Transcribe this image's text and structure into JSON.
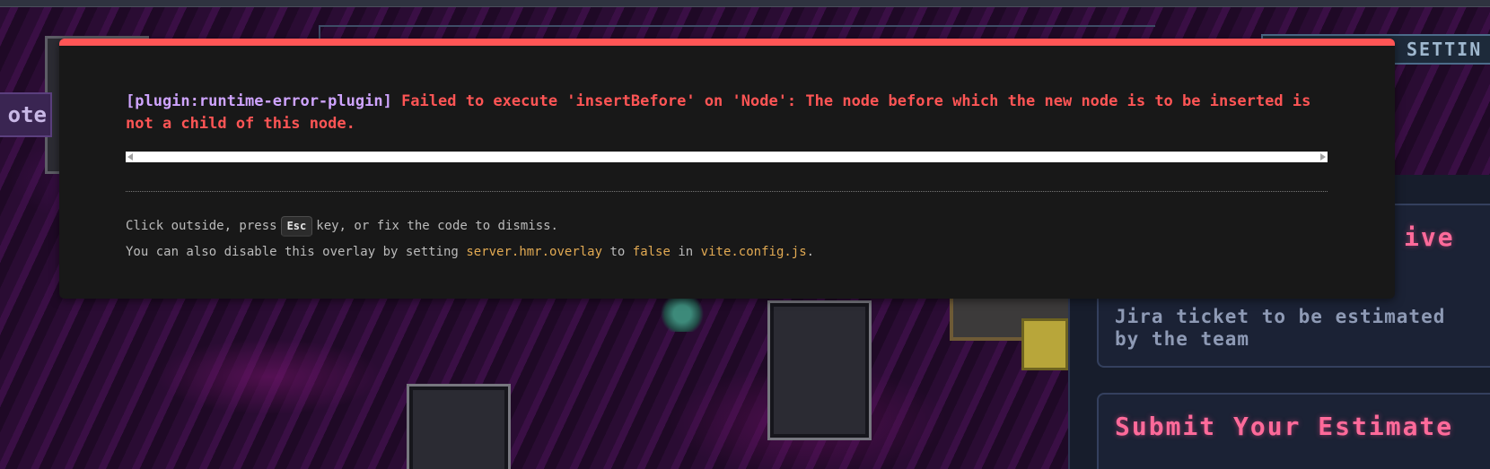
{
  "background": {
    "note_button_label": "ote",
    "settings_label": "SETTIN",
    "active_card": {
      "title": "ive",
      "description": "Jira ticket to be estimated by the team"
    },
    "submit_card": {
      "title": "Submit Your Estimate"
    }
  },
  "overlay": {
    "plugin": "[plugin:runtime-error-plugin]",
    "message": "Failed to execute 'insertBefore' on 'Node': The node before which the new node is to be inserted is not a child of this node.",
    "tip_click": "Click outside, press",
    "tip_key": "Esc",
    "tip_after_key": "key, or fix the code to dismiss.",
    "tip_disable_prefix": "You can also disable this overlay by setting",
    "config_option": "server.hmr.overlay",
    "to": "to",
    "config_value": "false",
    "in": "in",
    "config_file": "vite.config.js",
    "period": "."
  },
  "colors": {
    "error_red": "#ff5555",
    "plugin_purple": "#cfa4ff",
    "code_yellow": "#e2aa53",
    "overlay_bg": "#181818"
  }
}
